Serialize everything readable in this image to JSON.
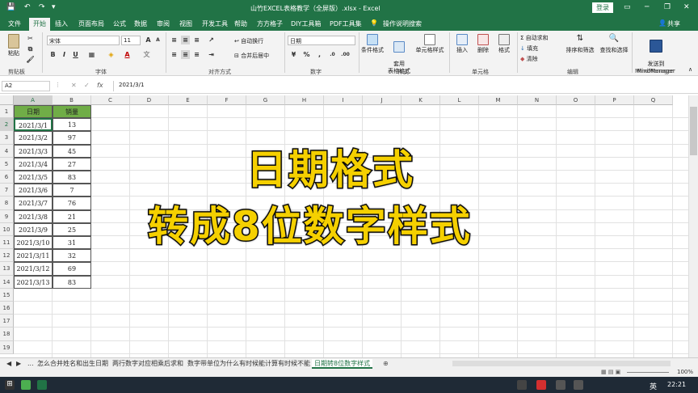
{
  "titlebar": {
    "title": "山竹EXCEL表格教学（全屏版）.xlsx - Excel",
    "login": "登录",
    "quick_access": [
      "save-icon",
      "undo-icon",
      "redo-icon"
    ],
    "window_controls": [
      "ribbon-display-icon",
      "minimize-icon",
      "restore-icon",
      "close-icon"
    ]
  },
  "tabs": [
    "文件",
    "开始",
    "插入",
    "页面布局",
    "公式",
    "数据",
    "审阅",
    "视图",
    "开发工具",
    "帮助",
    "方方格子",
    "DIY工具箱",
    "PDF工具集"
  ],
  "tabs_active": "开始",
  "tell_me": "操作说明搜索",
  "share": "共享",
  "ribbon": {
    "clipboard": {
      "paste": "粘贴",
      "label": "剪贴板"
    },
    "font": {
      "name": "宋体",
      "size": "11",
      "label": "字体",
      "bold": "B",
      "italic": "I",
      "underline": "U",
      "grow": "A",
      "shrink": "A"
    },
    "alignment": {
      "wrap": "自动换行",
      "merge": "合并后居中",
      "label": "对齐方式"
    },
    "number": {
      "format": "日期",
      "label": "数字"
    },
    "styles": {
      "conditional": "条件格式",
      "table_fmt": "套用\n表格格式",
      "cell_styles": "单元格样式",
      "label": "样式"
    },
    "cells": {
      "insert": "插入",
      "delete": "删除",
      "format": "格式",
      "label": "单元格"
    },
    "editing": {
      "autosum": "自动求和",
      "fill": "填充",
      "clear": "清除",
      "sort": "排序和筛选",
      "find": "查找和选择",
      "label": "编辑"
    },
    "mindmanager": {
      "send": "发送到\nMindManager",
      "label": "MindManager"
    }
  },
  "formula_bar": {
    "name_box": "A2",
    "fx": "fx",
    "value": "2021/3/1"
  },
  "columns": [
    "A",
    "B",
    "C",
    "D",
    "E",
    "F",
    "G",
    "H",
    "I",
    "J",
    "K",
    "L",
    "M",
    "N",
    "O",
    "P",
    "Q"
  ],
  "rows": [
    "1",
    "2",
    "3",
    "4",
    "5",
    "6",
    "7",
    "8",
    "9",
    "10",
    "11",
    "12",
    "13",
    "14",
    "15",
    "16",
    "17",
    "18",
    "19"
  ],
  "table": {
    "headers": [
      "日期",
      "销量"
    ],
    "rows": [
      [
        "2021/3/1",
        "13"
      ],
      [
        "2021/3/2",
        "97"
      ],
      [
        "2021/3/3",
        "45"
      ],
      [
        "2021/3/4",
        "27"
      ],
      [
        "2021/3/5",
        "83"
      ],
      [
        "2021/3/6",
        "7"
      ],
      [
        "2021/3/7",
        "76"
      ],
      [
        "2021/3/8",
        "21"
      ],
      [
        "2021/3/9",
        "25"
      ],
      [
        "2021/3/10",
        "31"
      ],
      [
        "2021/3/11",
        "32"
      ],
      [
        "2021/3/12",
        "69"
      ],
      [
        "2021/3/13",
        "83"
      ]
    ],
    "header_color": "#70ad47"
  },
  "overlay": {
    "line1": "日期格式",
    "line2": "转成8位数字样式"
  },
  "sheets": {
    "nav": [
      "◀",
      "▶",
      "..."
    ],
    "tabs": [
      "怎么合并姓名和出生日期",
      "两行数字对应相乘后求和",
      "数字带单位为什么有时候能计算有时候不能",
      "日期转8位数字样式"
    ],
    "active": "日期转8位数字样式",
    "add": "⊕"
  },
  "status": {
    "zoom": "100%"
  },
  "taskbar": {
    "lang": "英",
    "time": "22:21"
  },
  "colors": {
    "excel_green": "#217346",
    "overlay_yellow": "#f5d000",
    "taskbar": "#1f2a36"
  }
}
